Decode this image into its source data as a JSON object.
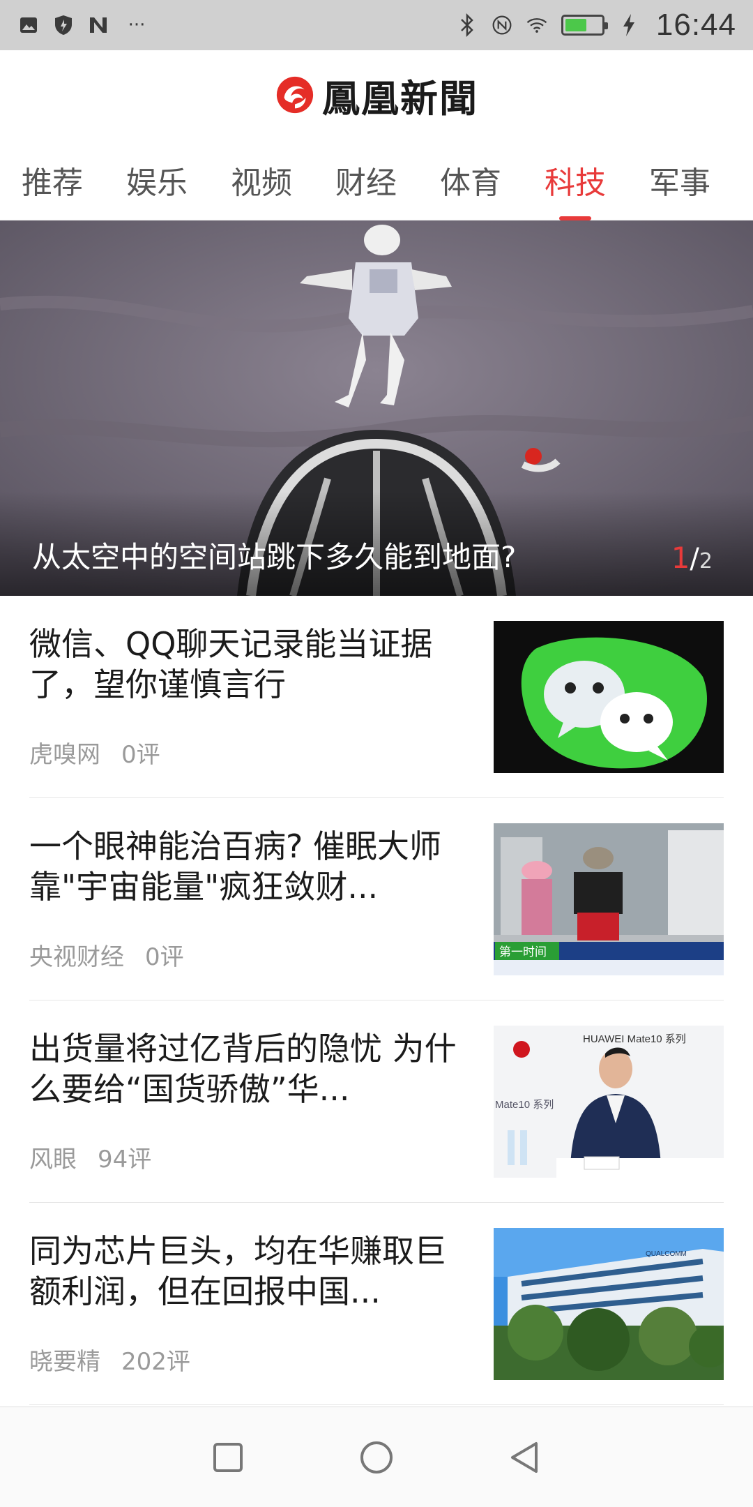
{
  "status_bar": {
    "time": "16:44",
    "left_icons": [
      "image-icon",
      "shield-icon",
      "n-icon",
      "more-icon"
    ],
    "right_icons": [
      "bluetooth-icon",
      "nfc-icon",
      "wifi-icon",
      "battery-icon",
      "charging-icon"
    ],
    "battery_level": 0.6,
    "more_label": "···"
  },
  "app": {
    "logo_text": "鳳凰新聞"
  },
  "tabs": [
    {
      "label": "推荐"
    },
    {
      "label": "娱乐"
    },
    {
      "label": "视频"
    },
    {
      "label": "财经"
    },
    {
      "label": "体育"
    },
    {
      "label": "科技",
      "active": true
    },
    {
      "label": "军事"
    }
  ],
  "hero": {
    "caption": "从太空中的空间站跳下多久能到地面?",
    "page_current": "1",
    "page_separator": "/",
    "page_total": "2"
  },
  "news": [
    {
      "title": " 微信、QQ聊天记录能当证据了，望你谨慎言行",
      "source": "虎嗅网",
      "comments": "0评",
      "thumb": "wechat"
    },
    {
      "title": "一个眼神能治百病? 催眠大师靠\"宇宙能量\"疯狂敛财...",
      "source": "央视财经",
      "comments": "0评",
      "thumb": "cctv"
    },
    {
      "title": "出货量将过亿背后的隐忧 为什么要给“国货骄傲”华...",
      "source": "风眼",
      "comments": "94评",
      "thumb": "huawei"
    },
    {
      "title": "同为芯片巨头，均在华赚取巨额利润，但在回报中国...",
      "source": "晓要精",
      "comments": "202评",
      "thumb": "qualcomm"
    }
  ],
  "thumb_text": {
    "cctv_label": "第一时间",
    "huawei_brand": "HUAWEI Mate10 系列",
    "huawei_side": "Mate10 系列",
    "qualcomm_sign": "QUALCOMM"
  },
  "colors": {
    "accent": "#e83a3a",
    "status_bar_bg": "#d0d0d0",
    "meta_text": "#9a9a9a"
  },
  "nav_bar": {
    "buttons": [
      "recent-apps-icon",
      "home-icon",
      "back-icon"
    ]
  }
}
